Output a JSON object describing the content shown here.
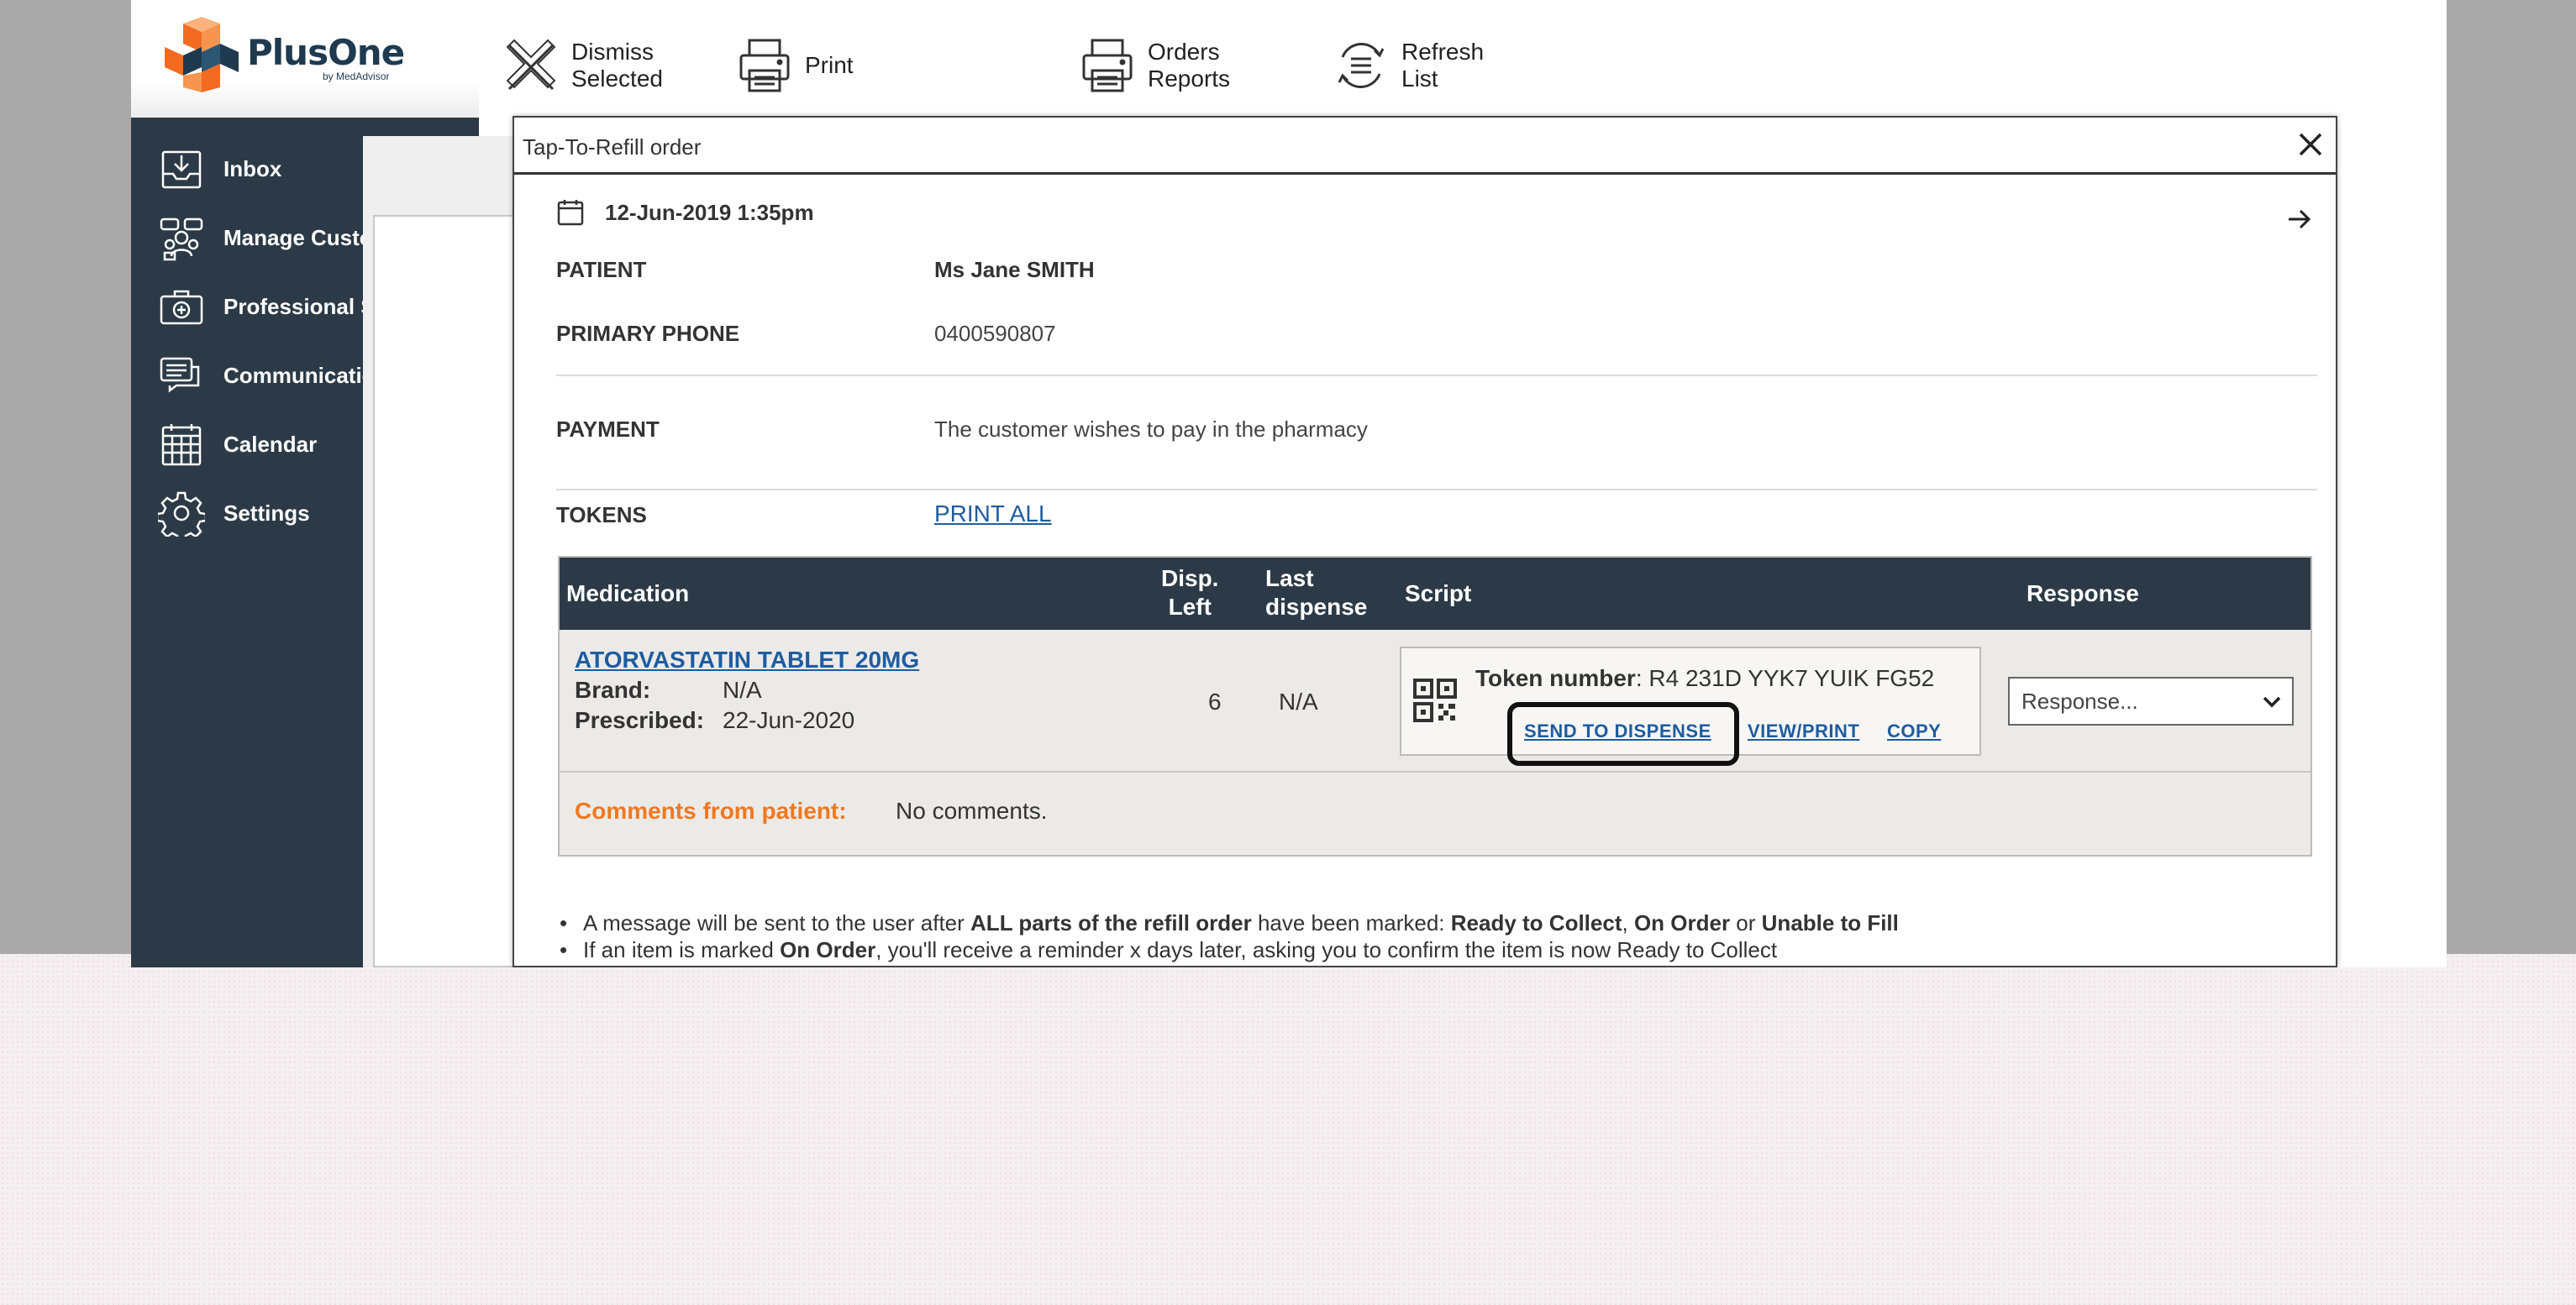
{
  "app": {
    "logo_text": "PlusOne",
    "logo_sub": "by MedAdvisor",
    "colors": {
      "sidebar": "#2b3a46",
      "link": "#1f5c9e",
      "accent": "#f07820",
      "logo_orange": "#f26b21"
    }
  },
  "sidebar": {
    "items": [
      {
        "label": "Inbox",
        "icon": "inbox-icon"
      },
      {
        "label": "Manage Customers",
        "icon": "customers-icon"
      },
      {
        "label": "Professional Services",
        "icon": "medical-kit-icon"
      },
      {
        "label": "Communications",
        "icon": "messages-icon"
      },
      {
        "label": "Calendar",
        "icon": "calendar-icon"
      },
      {
        "label": "Settings",
        "icon": "gear-icon"
      }
    ]
  },
  "toolbar": {
    "dismiss": "Dismiss\nSelected",
    "print": "Print",
    "orders_reports": "Orders\nReports",
    "refresh": "Refresh\nList"
  },
  "modal": {
    "title": "Tap-To-Refill order",
    "date": "12-Jun-2019  1:35pm",
    "patient_label": "PATIENT",
    "patient_value": "Ms Jane SMITH",
    "phone_label": "PRIMARY PHONE",
    "phone_value": "0400590807",
    "payment_label": "PAYMENT",
    "payment_value": "The customer wishes to pay in the pharmacy",
    "tokens_label": "TOKENS",
    "tokens_link": "PRINT ALL",
    "table": {
      "headers": {
        "medication": "Medication",
        "disp_left": "Disp.\nLeft",
        "last_dispense": "Last\ndispense",
        "script": "Script",
        "response": "Response"
      },
      "row": {
        "name": "ATORVASTATIN TABLET 20MG",
        "brand_label": "Brand:",
        "brand_value": "N/A",
        "prescribed_label": "Prescribed:",
        "prescribed_value": "22-Jun-2020",
        "disp_left": "6",
        "last_dispense": "N/A",
        "token_label": "Token number",
        "token_value": ": R4 231D YYK7 YUIK FG52",
        "send_to_dispense": "SEND TO DISPENSE",
        "view_print": "VIEW/PRINT",
        "copy": "COPY",
        "response_placeholder": "Response..."
      },
      "comments_label": "Comments from patient:",
      "comments_value": "No comments."
    },
    "notes": [
      {
        "parts": [
          "A message will be sent to the user after ",
          "ALL parts of the refill order",
          " have been marked: ",
          "Ready to Collect",
          ", ",
          "On Order",
          " or ",
          "Unable to Fill"
        ]
      },
      {
        "parts": [
          "If an item is marked ",
          "On Order",
          ", you'll receive a reminder x days later, asking you to confirm the item is now Ready to Collect"
        ]
      }
    ]
  }
}
